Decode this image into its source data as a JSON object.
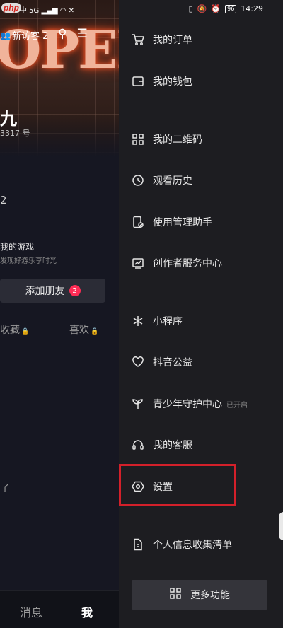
{
  "watermark": "php",
  "status_bar": {
    "left_text": "中 5G",
    "right_battery": "96",
    "right_time": "14:29"
  },
  "profile": {
    "cover_neon": "OPEN",
    "visitor_label": "新访客 2",
    "name_fragment": "九",
    "id_fragment": "3317 号",
    "stat_fragment": "2",
    "game_title": "我的游戏",
    "game_subtitle": "发现好游乐享时光",
    "add_friend_label": "添加朋友",
    "add_friend_badge": "2",
    "tab_favorites": "收藏",
    "tab_likes": "喜欢",
    "text_fragment": "了",
    "nav_messages": "消息",
    "nav_me": "我"
  },
  "drawer": {
    "items": [
      {
        "label": "我的订单",
        "icon": "cart-icon"
      },
      {
        "label": "我的钱包",
        "icon": "wallet-icon"
      },
      {
        "label": "我的二维码",
        "icon": "qrcode-icon"
      },
      {
        "label": "观看历史",
        "icon": "clock-icon"
      },
      {
        "label": "使用管理助手",
        "icon": "phone-manage-icon"
      },
      {
        "label": "创作者服务中心",
        "icon": "chart-board-icon"
      },
      {
        "label": "小程序",
        "icon": "asterisk-icon"
      },
      {
        "label": "抖音公益",
        "icon": "heart-icon"
      },
      {
        "label": "青少年守护中心",
        "icon": "sprout-icon",
        "sub": "已开启"
      },
      {
        "label": "我的客服",
        "icon": "headset-icon"
      },
      {
        "label": "设置",
        "icon": "hexagon-gear-icon"
      },
      {
        "label": "个人信息收集清单",
        "icon": "doc-list-icon"
      }
    ],
    "more_label": "更多功能"
  }
}
